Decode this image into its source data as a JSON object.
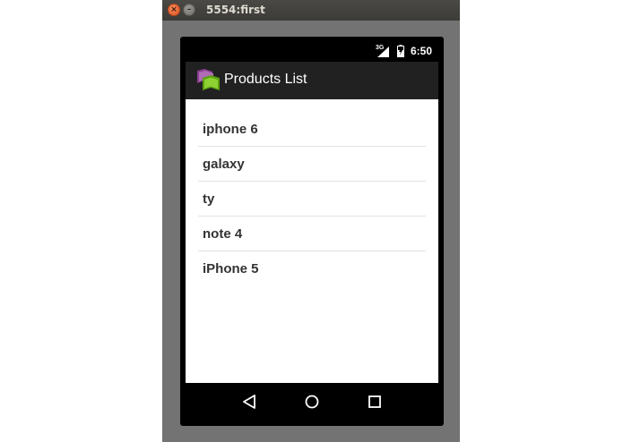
{
  "window": {
    "title": "5554:first",
    "close_symbol": "×",
    "minimize_symbol": "–"
  },
  "status_bar": {
    "network": "3G",
    "time": "6:50",
    "icons": [
      "signal-icon",
      "battery-icon"
    ]
  },
  "action_bar": {
    "title": "Products List",
    "icon": "app-icon"
  },
  "products": {
    "items": [
      "iphone 6",
      "galaxy",
      "ty",
      "note 4",
      "iPhone 5"
    ]
  },
  "nav_bar": {
    "buttons": [
      "back-icon",
      "home-icon",
      "recents-icon"
    ]
  },
  "colors": {
    "emulator_frame": "#737373",
    "action_bar": "#212121",
    "list_text": "#333333",
    "divider": "#e2e2e2"
  }
}
